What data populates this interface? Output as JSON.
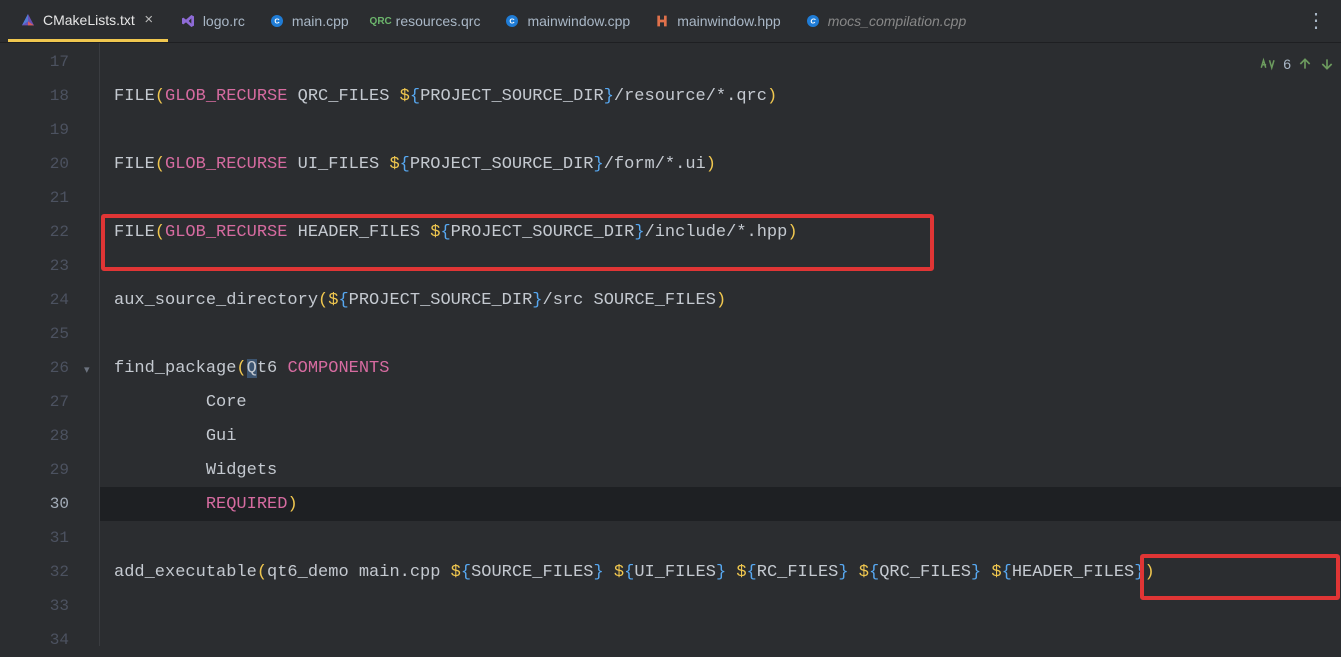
{
  "tabs": [
    {
      "label": "CMakeLists.txt",
      "icon": "cmake",
      "active": true,
      "closeable": true
    },
    {
      "label": "logo.rc",
      "icon": "vs",
      "active": false
    },
    {
      "label": "main.cpp",
      "icon": "cpp",
      "active": false
    },
    {
      "label": "resources.qrc",
      "icon": "qrc",
      "active": false
    },
    {
      "label": "mainwindow.cpp",
      "icon": "cpp",
      "active": false
    },
    {
      "label": "mainwindow.hpp",
      "icon": "hpp",
      "active": false
    },
    {
      "label": "mocs_compilation.cpp",
      "icon": "cpp",
      "active": false,
      "italic": true
    }
  ],
  "inspection": {
    "count": "6"
  },
  "lines": {
    "start": 17,
    "active": 30,
    "rows": [
      {
        "n": 17,
        "tokens": []
      },
      {
        "n": 18,
        "tokens": [
          {
            "t": "FILE",
            "c": "c-func"
          },
          {
            "t": "(",
            "c": "c-paren-y"
          },
          {
            "t": "GLOB_RECURSE",
            "c": "c-glob"
          },
          {
            "t": " QRC_FILES ",
            "c": "c-var"
          },
          {
            "t": "$",
            "c": "c-dollar"
          },
          {
            "t": "{",
            "c": "c-brace-b"
          },
          {
            "t": "PROJECT_SOURCE_DIR",
            "c": "c-inner"
          },
          {
            "t": "}",
            "c": "c-brace-b"
          },
          {
            "t": "/resource/*.qrc",
            "c": "c-path"
          },
          {
            "t": ")",
            "c": "c-paren-y"
          }
        ]
      },
      {
        "n": 19,
        "tokens": []
      },
      {
        "n": 20,
        "tokens": [
          {
            "t": "FILE",
            "c": "c-func"
          },
          {
            "t": "(",
            "c": "c-paren-y"
          },
          {
            "t": "GLOB_RECURSE",
            "c": "c-glob"
          },
          {
            "t": " UI_FILES ",
            "c": "c-var"
          },
          {
            "t": "$",
            "c": "c-dollar"
          },
          {
            "t": "{",
            "c": "c-brace-b"
          },
          {
            "t": "PROJECT_SOURCE_DIR",
            "c": "c-inner"
          },
          {
            "t": "}",
            "c": "c-brace-b"
          },
          {
            "t": "/form/*.ui",
            "c": "c-path"
          },
          {
            "t": ")",
            "c": "c-paren-y"
          }
        ]
      },
      {
        "n": 21,
        "tokens": []
      },
      {
        "n": 22,
        "tokens": [
          {
            "t": "FILE",
            "c": "c-func"
          },
          {
            "t": "(",
            "c": "c-paren-y"
          },
          {
            "t": "GLOB_RECURSE",
            "c": "c-glob"
          },
          {
            "t": " HEADER_FILES ",
            "c": "c-var"
          },
          {
            "t": "$",
            "c": "c-dollar"
          },
          {
            "t": "{",
            "c": "c-brace-b"
          },
          {
            "t": "PROJECT_SOURCE_DIR",
            "c": "c-inner"
          },
          {
            "t": "}",
            "c": "c-brace-b"
          },
          {
            "t": "/include/*.hpp",
            "c": "c-path"
          },
          {
            "t": ")",
            "c": "c-paren-y"
          }
        ]
      },
      {
        "n": 23,
        "tokens": []
      },
      {
        "n": 24,
        "tokens": [
          {
            "t": "aux_source_directory",
            "c": "c-func"
          },
          {
            "t": "(",
            "c": "c-paren-y"
          },
          {
            "t": "$",
            "c": "c-dollar"
          },
          {
            "t": "{",
            "c": "c-brace-b"
          },
          {
            "t": "PROJECT_SOURCE_DIR",
            "c": "c-inner"
          },
          {
            "t": "}",
            "c": "c-brace-b"
          },
          {
            "t": "/src SOURCE_FILES",
            "c": "c-path"
          },
          {
            "t": ")",
            "c": "c-paren-y"
          }
        ]
      },
      {
        "n": 25,
        "tokens": []
      },
      {
        "n": 26,
        "tokens": [
          {
            "t": "find_package",
            "c": "c-func"
          },
          {
            "t": "(",
            "c": "c-paren-y"
          },
          {
            "t": "Q",
            "c": "c-id c-cursor"
          },
          {
            "t": "t6 ",
            "c": "c-id"
          },
          {
            "t": "COMPONENTS",
            "c": "c-comp"
          }
        ],
        "fold": true
      },
      {
        "n": 27,
        "indent": 9,
        "tokens": [
          {
            "t": "Core",
            "c": "c-comp-val"
          }
        ]
      },
      {
        "n": 28,
        "indent": 9,
        "tokens": [
          {
            "t": "Gui",
            "c": "c-comp-val"
          }
        ]
      },
      {
        "n": 29,
        "indent": 9,
        "tokens": [
          {
            "t": "Widgets",
            "c": "c-comp-val"
          }
        ]
      },
      {
        "n": 30,
        "indent": 9,
        "tokens": [
          {
            "t": "REQUIRED",
            "c": "c-kw"
          },
          {
            "t": ")",
            "c": "c-paren-y"
          }
        ],
        "hl": true
      },
      {
        "n": 31,
        "tokens": []
      },
      {
        "n": 32,
        "tokens": [
          {
            "t": "add_executable",
            "c": "c-func"
          },
          {
            "t": "(",
            "c": "c-paren-y"
          },
          {
            "t": "qt6_demo main.cpp ",
            "c": "c-id"
          },
          {
            "t": "$",
            "c": "c-dollar"
          },
          {
            "t": "{",
            "c": "c-brace-b"
          },
          {
            "t": "SOURCE_FILES",
            "c": "c-inner"
          },
          {
            "t": "}",
            "c": "c-brace-b"
          },
          {
            "t": " ",
            "c": ""
          },
          {
            "t": "$",
            "c": "c-dollar"
          },
          {
            "t": "{",
            "c": "c-brace-b"
          },
          {
            "t": "UI_FILES",
            "c": "c-inner"
          },
          {
            "t": "}",
            "c": "c-brace-b"
          },
          {
            "t": " ",
            "c": ""
          },
          {
            "t": "$",
            "c": "c-dollar"
          },
          {
            "t": "{",
            "c": "c-brace-b"
          },
          {
            "t": "RC_FILES",
            "c": "c-inner"
          },
          {
            "t": "}",
            "c": "c-brace-b"
          },
          {
            "t": " ",
            "c": ""
          },
          {
            "t": "$",
            "c": "c-dollar"
          },
          {
            "t": "{",
            "c": "c-brace-b"
          },
          {
            "t": "QRC_FILES",
            "c": "c-inner"
          },
          {
            "t": "}",
            "c": "c-brace-b"
          },
          {
            "t": " ",
            "c": ""
          },
          {
            "t": "$",
            "c": "c-dollar"
          },
          {
            "t": "{",
            "c": "c-brace-b"
          },
          {
            "t": "HEADER_FILES",
            "c": "c-inner"
          },
          {
            "t": "}",
            "c": "c-brace-b"
          },
          {
            "t": ")",
            "c": "c-paren-y"
          }
        ]
      },
      {
        "n": 33,
        "tokens": []
      },
      {
        "n": 34,
        "tokens": []
      }
    ]
  }
}
